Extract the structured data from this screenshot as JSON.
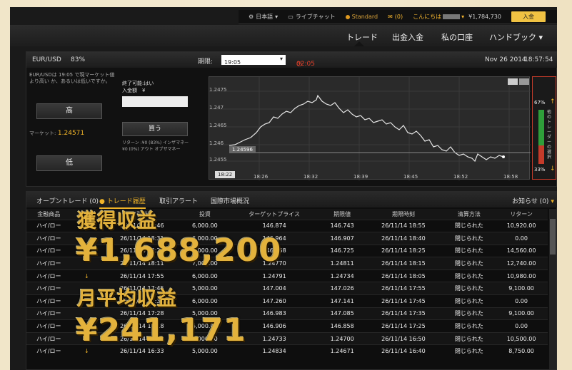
{
  "topbar": {
    "language": "日本語",
    "chat": "ライブチャット",
    "account_type": "Standard",
    "messages": "(0)",
    "greeting": "こんにちは",
    "balance": "¥1,784,730",
    "deposit": "入金"
  },
  "nav": {
    "items": [
      "トレード",
      "出金入金",
      "私の口座",
      "ハンドブック"
    ]
  },
  "trade": {
    "pair": "EUR/USD",
    "percent": "83%",
    "expiry_label": "期限:",
    "expiry_value": "19:05",
    "countdown": "02:05",
    "date": "Nov 26 2014",
    "time": "18:57:54",
    "description": "EUR/USDは 19:05 で現マーケット値より高い か、あるいは低いですか。",
    "high": "高",
    "market_label": "マーケット:",
    "market_value": "1.24571",
    "low": "低",
    "sell_label": "終了可能:はい",
    "amount_label": "入金額　¥",
    "buy": "買う",
    "return_in": "リターン :¥0 (83%) インザマネー",
    "return_out": "¥0 (0%) アウト オブザマネー",
    "y_ticks": [
      "1.2475",
      "1.247",
      "1.2465",
      "1.246",
      "1.2455"
    ],
    "x_ticks": [
      "18:26",
      "18:32",
      "18:39",
      "18:45",
      "18:52",
      "18:58"
    ],
    "x_start": "18:22",
    "price_marker": "1.24596",
    "up_pct": "67%",
    "down_pct": "33%",
    "gauge_text": "他のトレーダーの選択"
  },
  "history": {
    "tabs": [
      "オープントレード (0)",
      "● トレード履歴",
      "取引アラート",
      "国際市場概況"
    ],
    "notice": "お知らせ (0)",
    "headers": [
      "金融商品",
      "タイプ",
      "取引時間",
      "投資",
      "ターゲットプライス",
      "期限値",
      "期限時刻",
      "清算方法",
      "リターン"
    ],
    "rows": [
      [
        "ハイ/ロー",
        "",
        "26/11/14 18:46",
        "6,000.00",
        "146.874",
        "146.743",
        "26/11/14 18:55",
        "閉じられた",
        "10,920.00"
      ],
      [
        "ハイ/ロー",
        "",
        "26/11/14 18:31",
        "6,000.00",
        "146.964",
        "146.907",
        "26/11/14 18:40",
        "閉じられた",
        "0.00"
      ],
      [
        "ハイ/ロー",
        "",
        "26/11/14 18:21",
        "8,000.00",
        "146.858",
        "146.725",
        "26/11/14 18:25",
        "閉じられた",
        "14,560.00"
      ],
      [
        "ハイ/ロー",
        "",
        "26/11/14 18:11",
        "7,000.00",
        "1.24770",
        "1.24811",
        "26/11/14 18:15",
        "閉じられた",
        "12,740.00"
      ],
      [
        "ハイ/ロー",
        "↓",
        "26/11/14 17:55",
        "6,000.00",
        "1.24791",
        "1.24734",
        "26/11/14 18:05",
        "閉じられた",
        "10,980.00"
      ],
      [
        "ハイ/ロー",
        "",
        "26/11/14 17:45",
        "5,000.00",
        "147.004",
        "147.026",
        "26/11/14 17:55",
        "閉じられた",
        "9,100.00"
      ],
      [
        "ハイ/ロー",
        "",
        "26/11/14 17:38",
        "6,000.00",
        "147.260",
        "147.141",
        "26/11/14 17:45",
        "閉じられた",
        "0.00"
      ],
      [
        "ハイ/ロー",
        "",
        "26/11/14 17:28",
        "5,000.00",
        "146.983",
        "147.085",
        "26/11/14 17:35",
        "閉じられた",
        "9,100.00"
      ],
      [
        "ハイ/ロー",
        "↓",
        "26/11/14 17:18",
        "5,000.00",
        "146.906",
        "146.858",
        "26/11/14 17:25",
        "閉じられた",
        "0.00"
      ],
      [
        "ハイ/ロー",
        "",
        "26/11/14 16:42",
        "6,000.00",
        "1.24733",
        "1.24700",
        "26/11/14 16:50",
        "閉じられた",
        "10,500.00"
      ],
      [
        "ハイ/ロー",
        "↓",
        "26/11/14 16:33",
        "5,000.00",
        "1.24834",
        "1.24671",
        "26/11/14 16:40",
        "閉じられた",
        "8,750.00"
      ]
    ]
  },
  "promo": {
    "label1": "獲得収益",
    "amount1": "¥1,688,200",
    "label2": "月平均収益",
    "amount2": "¥241,171"
  },
  "colors": {
    "accent": "#f0c243",
    "up": "#2f9e3a",
    "down": "#c43b2a"
  }
}
